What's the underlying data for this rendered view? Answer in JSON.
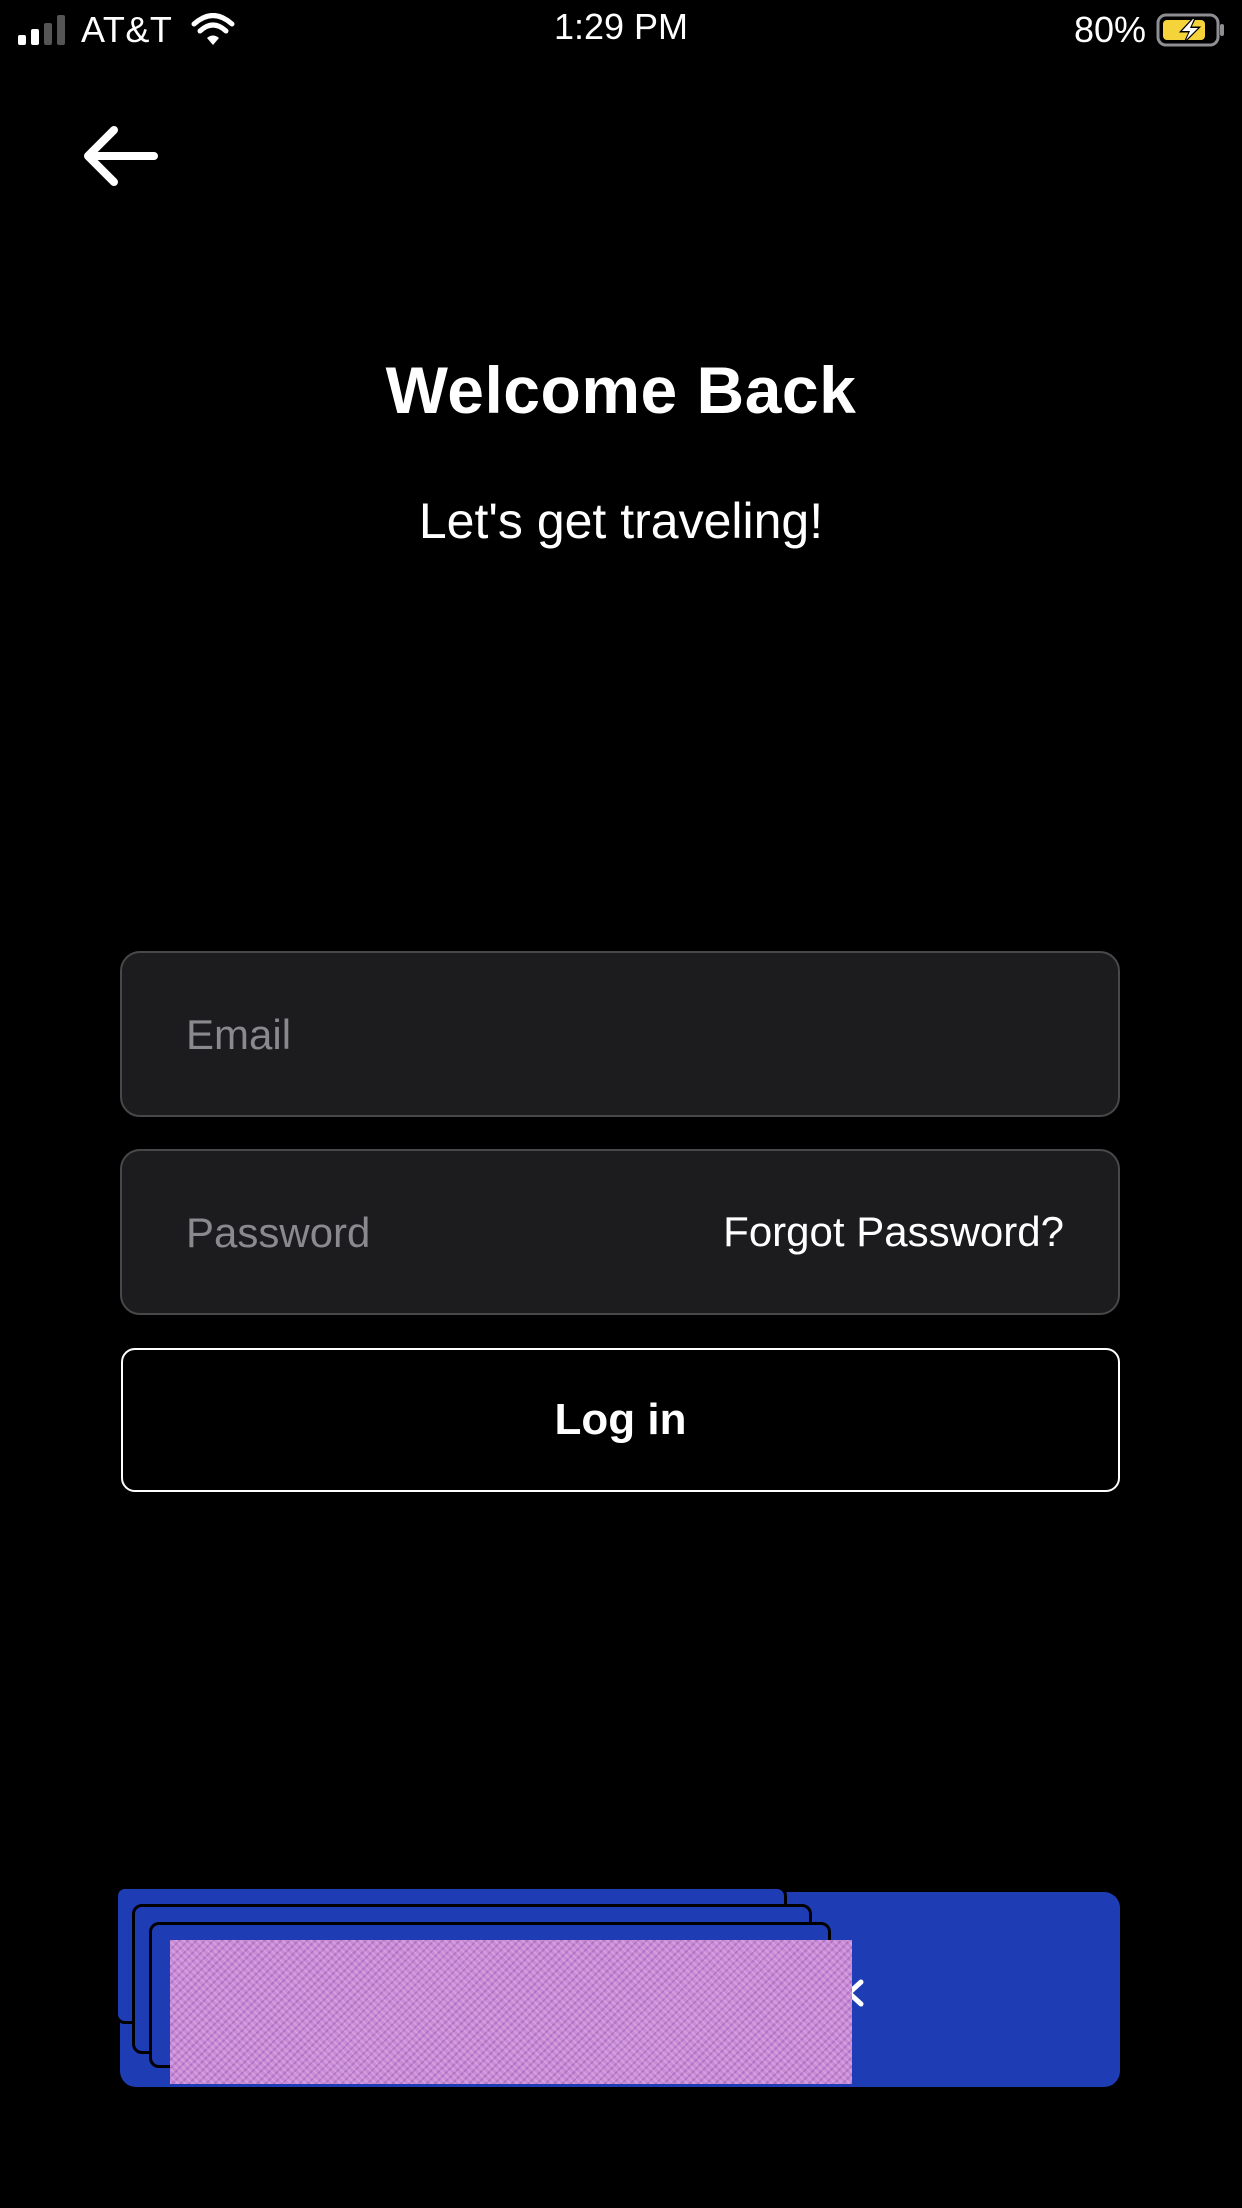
{
  "status_bar": {
    "carrier": "AT&T",
    "time": "1:29 PM",
    "battery_percent": "80%",
    "signal_bars": 2,
    "signal_bars_total": 4,
    "battery_charging": true
  },
  "nav": {
    "back_icon": "arrow-left-icon"
  },
  "header": {
    "title": "Welcome Back",
    "subtitle": "Let's get traveling!"
  },
  "form": {
    "email": {
      "placeholder": "Email",
      "value": ""
    },
    "password": {
      "placeholder": "Password",
      "value": ""
    },
    "forgot_password_label": "Forgot Password?",
    "login_label": "Log in"
  },
  "social_button": {
    "icon": "chevron-left-icon",
    "label_redacted": true
  },
  "colors": {
    "background": "#000000",
    "field_background": "#1c1c1e",
    "field_border": "#48484a",
    "placeholder": "#8a8a8e",
    "accent_blue": "#1e3db5",
    "battery_yellow": "#f5d33b"
  }
}
